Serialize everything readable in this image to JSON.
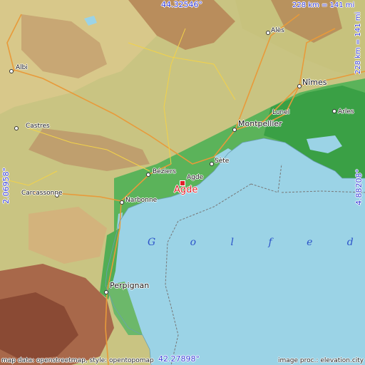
{
  "map": {
    "colors": {
      "sea": "#9bd3e6",
      "lowland": "#3fa44a",
      "hills": "#c8c07a",
      "mountains": "#b8784a",
      "coord_text": "#3a40d6",
      "target": "#e0202a"
    },
    "coordinates": {
      "top": "44.32546°",
      "bottom": "42.27898°",
      "left": "2.06958°",
      "right": "4.88208°"
    },
    "scale": {
      "top": "228 km = 141 mi",
      "right": "228 km = 141 mi"
    },
    "water_label": "G o l f e   d u   L",
    "target_city": "Agde",
    "places": {
      "ales": "Alès",
      "albi": "Albi",
      "nimes": "Nîmes",
      "lunel": "Lunel",
      "arles": "Arles",
      "montpellier": "Montpellier",
      "castres": "Castres",
      "sete": "Sète",
      "beziers": "Béziers",
      "agde_small": "Agde",
      "carcassonne": "Carcassonne",
      "narbonne": "Narbonne",
      "perpignan": "Perpignan"
    },
    "credits": {
      "left": "map data: openstreetmap, style: opentopomap",
      "right": "image proc.: elevation.city"
    }
  }
}
